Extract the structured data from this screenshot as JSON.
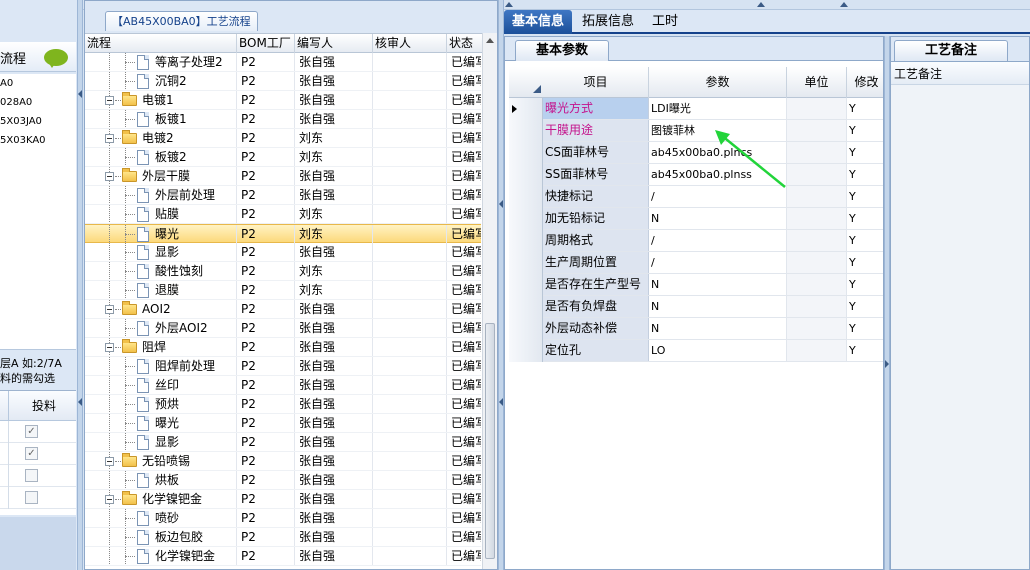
{
  "left_panel": {
    "header_label": "流程",
    "items": [
      "A0",
      "028A0",
      "5X03JA0",
      "5X03KA0"
    ],
    "note_line1": "层A 如:2/7A",
    "note_line2": "料的需勾选",
    "grid_header": "投料",
    "checkbox_rows": [
      true,
      true,
      false,
      false
    ]
  },
  "middle_panel": {
    "title": "【AB45X00BA0】工艺流程",
    "columns": [
      "流程",
      "BOM工厂",
      "编写人",
      "核审人",
      "状态"
    ],
    "rows": [
      {
        "level": 1,
        "type": "doc",
        "name": "等离子处理2",
        "factory": "P2",
        "writer": "张自强",
        "reviewer": "",
        "status": "已编写"
      },
      {
        "level": 1,
        "type": "doc",
        "name": "沉铜2",
        "factory": "P2",
        "writer": "张自强",
        "reviewer": "",
        "status": "已编写"
      },
      {
        "level": 0,
        "type": "folder",
        "name": "电镀1",
        "factory": "P2",
        "writer": "张自强",
        "reviewer": "",
        "status": "已编写"
      },
      {
        "level": 1,
        "type": "doc",
        "name": "板镀1",
        "factory": "P2",
        "writer": "张自强",
        "reviewer": "",
        "status": "已编写"
      },
      {
        "level": 0,
        "type": "folder",
        "name": "电镀2",
        "factory": "P2",
        "writer": "刘东",
        "reviewer": "",
        "status": "已编写"
      },
      {
        "level": 1,
        "type": "doc",
        "name": "板镀2",
        "factory": "P2",
        "writer": "刘东",
        "reviewer": "",
        "status": "已编写"
      },
      {
        "level": 0,
        "type": "folder",
        "name": "外层干膜",
        "factory": "P2",
        "writer": "张自强",
        "reviewer": "",
        "status": "已编写"
      },
      {
        "level": 1,
        "type": "doc",
        "name": "外层前处理",
        "factory": "P2",
        "writer": "张自强",
        "reviewer": "",
        "status": "已编写"
      },
      {
        "level": 1,
        "type": "doc",
        "name": "贴膜",
        "factory": "P2",
        "writer": "刘东",
        "reviewer": "",
        "status": "已编写"
      },
      {
        "level": 1,
        "type": "doc",
        "name": "曝光",
        "factory": "P2",
        "writer": "刘东",
        "reviewer": "",
        "status": "已编写",
        "selected": true
      },
      {
        "level": 1,
        "type": "doc",
        "name": "显影",
        "factory": "P2",
        "writer": "张自强",
        "reviewer": "",
        "status": "已编写"
      },
      {
        "level": 1,
        "type": "doc",
        "name": "酸性蚀刻",
        "factory": "P2",
        "writer": "刘东",
        "reviewer": "",
        "status": "已编写"
      },
      {
        "level": 1,
        "type": "doc",
        "name": "退膜",
        "factory": "P2",
        "writer": "刘东",
        "reviewer": "",
        "status": "已编写"
      },
      {
        "level": 0,
        "type": "folder",
        "name": "AOI2",
        "factory": "P2",
        "writer": "张自强",
        "reviewer": "",
        "status": "已编写"
      },
      {
        "level": 1,
        "type": "doc",
        "name": "外层AOI2",
        "factory": "P2",
        "writer": "张自强",
        "reviewer": "",
        "status": "已编写"
      },
      {
        "level": 0,
        "type": "folder",
        "name": "阻焊",
        "factory": "P2",
        "writer": "张自强",
        "reviewer": "",
        "status": "已编写"
      },
      {
        "level": 1,
        "type": "doc",
        "name": "阻焊前处理",
        "factory": "P2",
        "writer": "张自强",
        "reviewer": "",
        "status": "已编写"
      },
      {
        "level": 1,
        "type": "doc",
        "name": "丝印",
        "factory": "P2",
        "writer": "张自强",
        "reviewer": "",
        "status": "已编写"
      },
      {
        "level": 1,
        "type": "doc",
        "name": "预烘",
        "factory": "P2",
        "writer": "张自强",
        "reviewer": "",
        "status": "已编写"
      },
      {
        "level": 1,
        "type": "doc",
        "name": "曝光",
        "factory": "P2",
        "writer": "张自强",
        "reviewer": "",
        "status": "已编写"
      },
      {
        "level": 1,
        "type": "doc",
        "name": "显影",
        "factory": "P2",
        "writer": "张自强",
        "reviewer": "",
        "status": "已编写"
      },
      {
        "level": 0,
        "type": "folder",
        "name": "无铅喷锡",
        "factory": "P2",
        "writer": "张自强",
        "reviewer": "",
        "status": "已编写"
      },
      {
        "level": 1,
        "type": "doc",
        "name": "烘板",
        "factory": "P2",
        "writer": "张自强",
        "reviewer": "",
        "status": "已编写"
      },
      {
        "level": 0,
        "type": "folder",
        "name": "化学镍钯金",
        "factory": "P2",
        "writer": "张自强",
        "reviewer": "",
        "status": "已编写"
      },
      {
        "level": 1,
        "type": "doc",
        "name": "喷砂",
        "factory": "P2",
        "writer": "张自强",
        "reviewer": "",
        "status": "已编写"
      },
      {
        "level": 1,
        "type": "doc",
        "name": "板边包胶",
        "factory": "P2",
        "writer": "张自强",
        "reviewer": "",
        "status": "已编写"
      },
      {
        "level": 1,
        "type": "doc",
        "name": "化学镍钯金",
        "factory": "P2",
        "writer": "张自强",
        "reviewer": "",
        "status": "已编写"
      }
    ]
  },
  "top_tabs": [
    "基本信息",
    "拓展信息",
    "工时"
  ],
  "basic_panel": {
    "tab_label": "基本参数",
    "columns": [
      "项目",
      "参数",
      "单位",
      "修改"
    ],
    "rows": [
      {
        "item": "曝光方式",
        "param": "LDI曝光",
        "unit": "",
        "flag": "Y",
        "pink": true,
        "current": true
      },
      {
        "item": "干膜用途",
        "param": "图镀菲林",
        "unit": "",
        "flag": "Y",
        "pink": true
      },
      {
        "item": "CS面菲林号",
        "param": "ab45x00ba0.plncs",
        "unit": "",
        "flag": "Y"
      },
      {
        "item": "SS面菲林号",
        "param": "ab45x00ba0.plnss",
        "unit": "",
        "flag": "Y"
      },
      {
        "item": "快捷标记",
        "param": "/",
        "unit": "",
        "flag": "Y"
      },
      {
        "item": "加无铅标记",
        "param": "N",
        "unit": "",
        "flag": "Y"
      },
      {
        "item": "周期格式",
        "param": "/",
        "unit": "",
        "flag": "Y"
      },
      {
        "item": "生产周期位置",
        "param": "/",
        "unit": "",
        "flag": "Y"
      },
      {
        "item": "是否存在生产型号",
        "param": "N",
        "unit": "",
        "flag": "Y"
      },
      {
        "item": "是否有负焊盘",
        "param": "N",
        "unit": "",
        "flag": "Y"
      },
      {
        "item": "外层动态补偿",
        "param": "N",
        "unit": "",
        "flag": "Y"
      },
      {
        "item": "定位孔",
        "param": "LO",
        "unit": "",
        "flag": "Y"
      }
    ]
  },
  "remark_panel": {
    "tab_label": "工艺备注",
    "header": "工艺备注"
  },
  "colors": {
    "accent": "#15428b",
    "highlight_text": "#c4138c",
    "annotation_arrow": "#22d43a",
    "selected_row": "#fcd97c"
  }
}
